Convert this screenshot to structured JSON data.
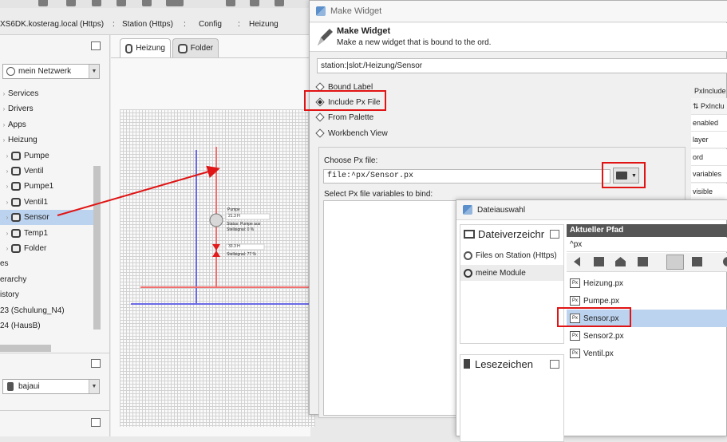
{
  "breadcrumb": {
    "items": [
      "XS6DK.kosterag.local (Https)",
      "Station (Https)",
      "Config",
      "Heizung"
    ],
    "separator": ":"
  },
  "nav": {
    "network_dropdown": "mein Netzwerk",
    "tree": [
      {
        "label": "Services",
        "indent": 0,
        "folder": false
      },
      {
        "label": "Drivers",
        "indent": 0,
        "folder": false
      },
      {
        "label": "Apps",
        "indent": 0,
        "folder": false
      },
      {
        "label": "Heizung",
        "indent": 0,
        "folder": false
      },
      {
        "label": "Pumpe",
        "indent": 1,
        "folder": true
      },
      {
        "label": "Ventil",
        "indent": 1,
        "folder": true
      },
      {
        "label": "Pumpe1",
        "indent": 1,
        "folder": true
      },
      {
        "label": "Ventil1",
        "indent": 1,
        "folder": true
      },
      {
        "label": "Sensor",
        "indent": 1,
        "folder": true,
        "selected": true
      },
      {
        "label": "Temp1",
        "indent": 1,
        "folder": true
      },
      {
        "label": "Folder",
        "indent": 1,
        "folder": true
      },
      {
        "label": "es",
        "indent": 0,
        "folder": false
      },
      {
        "label": "erarchy",
        "indent": 0,
        "folder": false
      },
      {
        "label": "istory",
        "indent": 0,
        "folder": false
      },
      {
        "label": "23 (Schulung_N4)",
        "indent": 0,
        "folder": false
      },
      {
        "label": "24 (HausB)",
        "indent": 0,
        "folder": false
      }
    ],
    "palette_dropdown": "bajaui"
  },
  "view": {
    "tabs": [
      "Heizung",
      "Folder"
    ],
    "widgets": {
      "pump_label": "Pumpe",
      "pump_value": "21.3 H",
      "pump_status": "Status: Pumpe aus",
      "pump_signal": "Stellsignal: 0 %",
      "valve_value": "33.3 H",
      "valve_signal": "Stellsignal: 77 %"
    }
  },
  "dialog": {
    "title": "Make Widget",
    "header_title": "Make Widget",
    "header_subtitle": "Make a new widget that is bound to the ord.",
    "ord": "station:|slot:/Heizung/Sensor",
    "options": [
      {
        "label": "Bound Label",
        "selected": false
      },
      {
        "label": "Include Px File",
        "selected": true
      },
      {
        "label": "From Palette",
        "selected": false
      },
      {
        "label": "Workbench View",
        "selected": false
      }
    ],
    "choose_label": "Choose Px file:",
    "px_file": "file:^px/Sensor.px",
    "vars_label": "Select Px file variables to bind:",
    "props_header": "PxInclude",
    "props_subheader": "PxInclu",
    "props": [
      "enabled",
      "layer",
      "ord",
      "variables",
      "visible"
    ]
  },
  "file_chooser": {
    "title": "Dateiauswahl",
    "dir_header": "Dateiverzeichr",
    "dir_items": [
      "Files on Station (Https)",
      "meine Module"
    ],
    "bookmarks_header": "Lesezeichen",
    "path_header": "Aktueller Pfad",
    "path_value": "^px",
    "files": [
      "Heizung.px",
      "Pumpe.px",
      "Sensor.px",
      "Sensor2.px",
      "Ventil.px"
    ],
    "selected_file": "Sensor.px",
    "file_icon_text": "Px"
  },
  "colors": {
    "annotation_red": "#e01414",
    "selection_blue": "#bcd3ef",
    "pipe_red": "#f07070",
    "pipe_blue": "#6a6ae6"
  }
}
